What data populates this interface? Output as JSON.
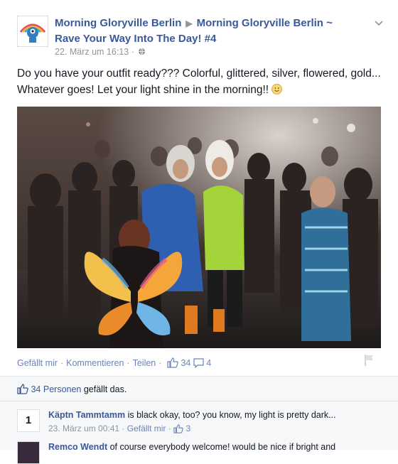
{
  "post": {
    "page_name": "Morning Gloryville Berlin",
    "event_title": "Morning Gloryville Berlin ~ Rave Your Way Into The Day! #4",
    "timestamp": "22. März um 16:13",
    "privacy_separator": "·",
    "text": "Do you have your outfit ready??? Colorful, glittered, silver, flowered, gold... Whatever goes! Let your light shine in the morning!!",
    "photo_description_icon": "party-photo"
  },
  "actions": {
    "like": "Gefällt mir",
    "comment": "Kommentieren",
    "share": "Teilen",
    "like_count": "34",
    "comment_count": "4"
  },
  "likes_summary": {
    "count_text": "34 Personen",
    "suffix": " gefällt das."
  },
  "comments": [
    {
      "avatar_label": "1",
      "author": "Käptn Tammtamm",
      "text": " is black okay, too? you know, my light is pretty dark...",
      "time": "23. März um 00:41",
      "like_label": "Gefällt mir",
      "likes": "3"
    },
    {
      "author": "Remco Wendt",
      "text": " of course everybody welcome! would be nice if bright and"
    }
  ],
  "colors": {
    "link": "#3b5998",
    "muted": "#90949c",
    "bg_comments": "#f6f7f9"
  }
}
